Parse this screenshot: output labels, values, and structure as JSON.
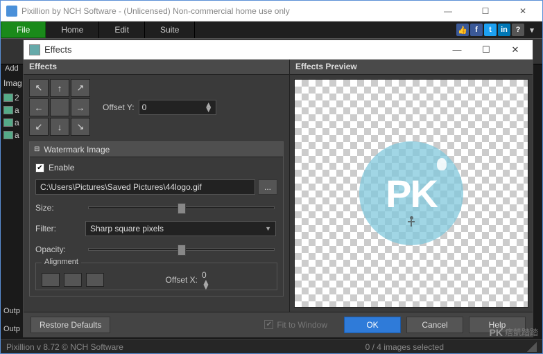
{
  "app": {
    "title": "Pixillion by NCH Software - (Unlicensed) Non-commercial home use only",
    "status_version": "Pixillion v 8.72 © NCH Software",
    "status_selection": "0 / 4 images selected"
  },
  "menu": {
    "file": "File",
    "home": "Home",
    "edit": "Edit",
    "suite": "Suite"
  },
  "sidebar": {
    "add_label": "Add",
    "images_label": "Imag",
    "row1": "2",
    "row2": "a",
    "row3": "a",
    "row4": "a",
    "outp1": "Outp",
    "outp2": "Outp"
  },
  "dialog": {
    "title": "Effects",
    "left_header": "Effects",
    "right_header": "Effects Preview",
    "offset_y_label": "Offset Y:",
    "offset_y_value": "0",
    "section_title": "Watermark Image",
    "enable_label": "Enable",
    "file_path": "C:\\Users\\Pictures\\Saved Pictures\\44logo.gif",
    "browse_label": "...",
    "size_label": "Size:",
    "filter_label": "Filter:",
    "filter_value": "Sharp square pixels",
    "opacity_label": "Opacity:",
    "alignment_label": "Alignment",
    "offset_x2_label": "Offset X:",
    "offset_x2_value": "0",
    "restore_label": "Restore Defaults",
    "fit_label": "Fit to Window",
    "ok_label": "OK",
    "cancel_label": "Cancel",
    "help_label": "Help",
    "logo_text": "PK"
  },
  "badge": {
    "pk": "PK",
    "txt": "痞凱踏踏"
  }
}
